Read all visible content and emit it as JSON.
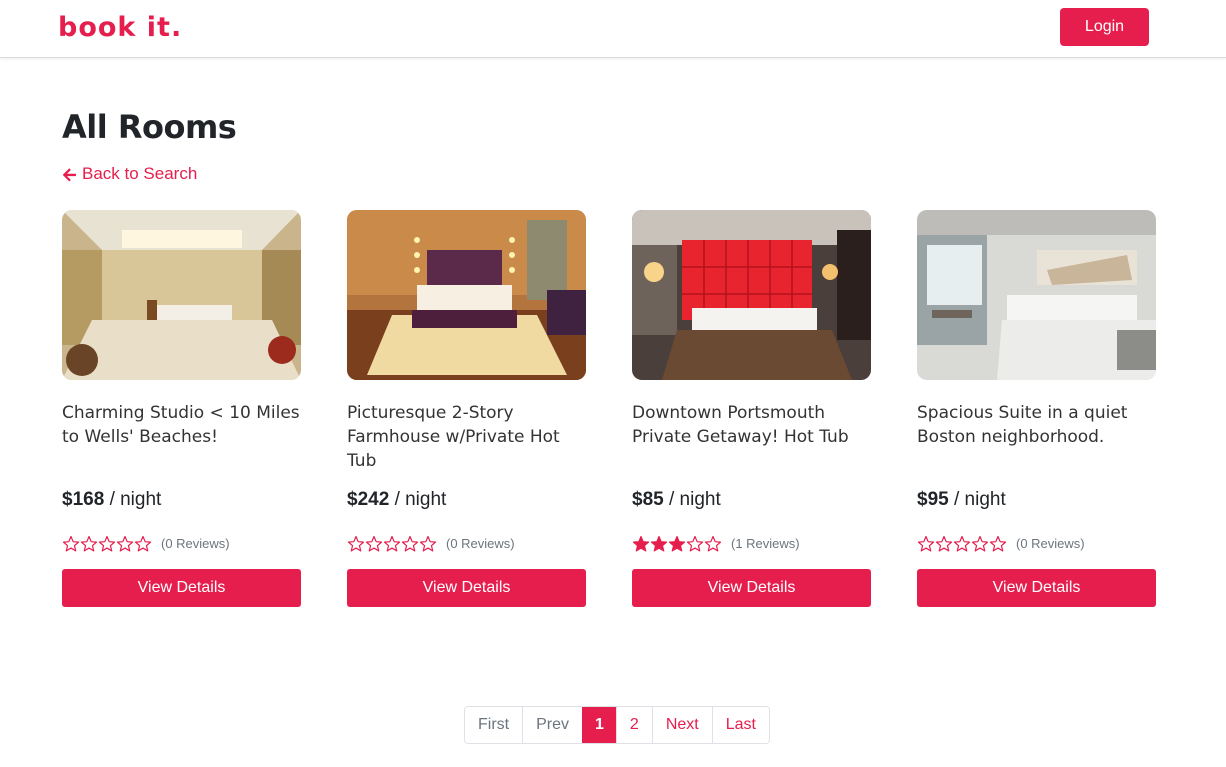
{
  "navbar": {
    "brand": "book it.",
    "login_label": "Login"
  },
  "page": {
    "title": "All Rooms",
    "back_label": "Back to Search"
  },
  "colors": {
    "accent": "#e61e4d"
  },
  "rooms": [
    {
      "title": "Charming Studio < 10 Miles to Wells' Beaches!",
      "price": "$168",
      "per": "/ night",
      "rating": 0,
      "reviews": "(0 Reviews)",
      "button": "View Details",
      "image": "hotel-room-photo"
    },
    {
      "title": "Picturesque 2-Story Farmhouse w/Private Hot Tub",
      "price": "$242",
      "per": "/ night",
      "rating": 0,
      "reviews": "(0 Reviews)",
      "button": "View Details",
      "image": "hotel-room-photo"
    },
    {
      "title": "Downtown Portsmouth Private Getaway! Hot Tub",
      "price": "$85",
      "per": "/ night",
      "rating": 3,
      "reviews": "(1 Reviews)",
      "button": "View Details",
      "image": "hotel-room-photo"
    },
    {
      "title": "Spacious Suite in a quiet Boston neighborhood.",
      "price": "$95",
      "per": "/ night",
      "rating": 0,
      "reviews": "(0 Reviews)",
      "button": "View Details",
      "image": "hotel-room-photo"
    }
  ],
  "pagination": {
    "first": "First",
    "prev": "Prev",
    "pages": [
      "1",
      "2"
    ],
    "current": "1",
    "next": "Next",
    "last": "Last"
  }
}
